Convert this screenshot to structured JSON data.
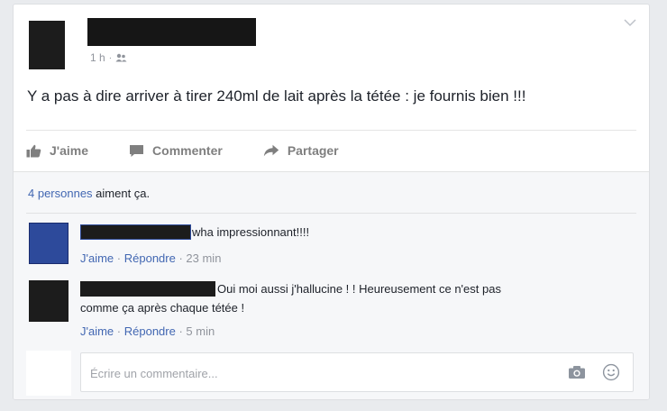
{
  "post": {
    "time": "1 h",
    "audience_icon": "friends-icon",
    "text": "Y a pas à dire arriver à tirer 240ml de lait après la tétée : je fournis bien !!!"
  },
  "actions": {
    "like": "J'aime",
    "comment": "Commenter",
    "share": "Partager"
  },
  "likes": {
    "link": "4 personnes",
    "suffix": " aiment ça."
  },
  "comments": [
    {
      "text": "wha impressionnant!!!!",
      "like": "J'aime",
      "reply": "Répondre",
      "sep": " · ",
      "time": "23 min",
      "avatar_color": "#2d4a9b"
    },
    {
      "text_line1": "Oui moi aussi j'hallucine ! ! Heureusement ce n'est pas",
      "text_line2": "comme ça après chaque tétée !",
      "like": "J'aime",
      "reply": "Répondre",
      "sep": " · ",
      "time": "5 min",
      "avatar_color": "#1c1c1c"
    }
  ],
  "composer": {
    "placeholder": "Écrire un commentaire..."
  },
  "colors": {
    "link": "#4267b2",
    "muted": "#90949c"
  }
}
